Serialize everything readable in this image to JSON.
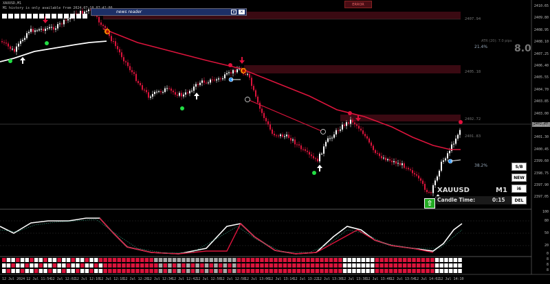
{
  "chart_header": {
    "symbol_line": "XAUUSD,M1",
    "history_notice": "M1 history is only available from 2024.07.10 07:42:00"
  },
  "news_reader": {
    "label": "news reader"
  },
  "top_badge": {
    "label": "ERROR"
  },
  "atr": {
    "label": "ATR (20): 7.0 pips",
    "value": "8.0"
  },
  "percent_labels": {
    "upper": "21.4%",
    "lower": "38.2%"
  },
  "zone_labels": [
    "2407.94",
    "2405.18",
    "2402.72",
    "2401.83"
  ],
  "symbol_panel": {
    "symbol": "XAUUSD",
    "timeframe": "M1",
    "candle_time_label": "Candle Time:",
    "candle_time_value": "0:15"
  },
  "side_buttons": [
    "S/B",
    "NEW",
    "i6",
    "DEL"
  ],
  "current_price": "2402.49",
  "price_axis": [
    "2410.65",
    "2409.80",
    "2408.95",
    "2408.10",
    "2407.25",
    "2406.40",
    "2405.55",
    "2404.70",
    "2403.85",
    "2403.00",
    "2402.15",
    "2401.30",
    "2400.45",
    "2399.60",
    "2398.75",
    "2397.90",
    "2397.05"
  ],
  "osc_axis": [
    "100",
    "80",
    "50",
    "20",
    "0"
  ],
  "strength_axis": [
    "8",
    "8",
    "8"
  ],
  "time_axis": [
    "12 Jul 2024",
    "12 Jul 11:54",
    "12 Jul 12:02",
    "12 Jul 12:10",
    "12 Jul 12:18",
    "12 Jul 12:26",
    "12 Jul 12:34",
    "12 Jul 12:42",
    "12 Jul 12:50",
    "12 Jul 12:58",
    "12 Jul 13:06",
    "12 Jul 13:14",
    "12 Jul 13:22",
    "12 Jul 13:30",
    "12 Jul 13:38",
    "12 Jul 13:46",
    "12 Jul 13:54",
    "12 Jul 14:02",
    "12 Jul 14:10"
  ],
  "colors": {
    "background": "#000000",
    "bull_candle": "#ffffff",
    "bear_candle": "#dc143c",
    "moving_average": "#dc143c",
    "lower_band": "#ffffff",
    "supply_zone": "#3a0a12",
    "buy_dot": "#22dd44",
    "sell_dot": "#e0103c",
    "osc_main": "#ffffff",
    "osc_red": "#dc143c",
    "strength_red": "#dc143c",
    "strength_white": "#ffffff",
    "strength_grey": "#aaaaaa",
    "buy_signal": "#22aa22"
  },
  "icons": [
    "news-reader-icon",
    "close-icon",
    "buy-signal-arrow-icon",
    "sell-signal-arrow-icon",
    "star-marker-icon"
  ]
}
